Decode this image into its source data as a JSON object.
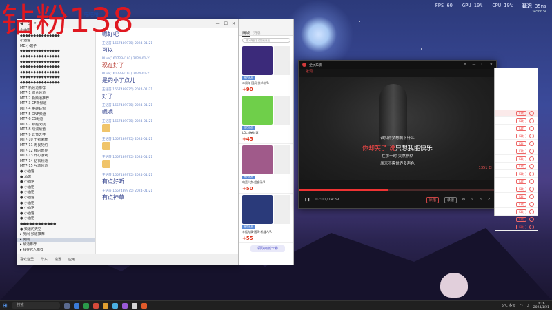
{
  "overlay_text": "钻粉138",
  "hud": {
    "fps": "FPS 60",
    "gpu": "GPU 10%",
    "cpu": "CPU 19%",
    "extra_label": "延迟",
    "extra_val": "35ms",
    "extra_sub": "13456634"
  },
  "chat": {
    "header_name": "喵喵哈",
    "sidebar_items": [
      "小酒馆",
      "◆◆◆◆◆◆◆◆◆◆◆◆◆◆◆",
      "小酒馆",
      "ME 小馆子",
      "◆◆◆◆◆◆◆◆◆◆◆◆◆◆◆",
      "◆◆◆◆◆◆◆◆◆◆◆◆◆◆◆",
      "◆◆◆◆◆◆◆◆◆◆◆◆◆◆◆",
      "◆◆◆◆◆◆◆◆◆◆◆◆◆◆◆",
      "◆◆◆◆◆◆◆◆◆◆◆◆◆◆◆",
      "◆◆◆◆◆◆◆◆◆◆◆◆◆◆◆",
      "◆◆◆◆◆◆◆◆◆◆◆◆◆◆◆",
      "MT7 新频道推荐",
      "MT7-1 综合频道",
      "MT7-2 新频道推荐",
      "MT7-3 CF新频道",
      "MT7-4 英雄联盟",
      "MT7-5 DNF频道",
      "MT7-6 CS频道",
      "MT7-7 穿越火线",
      "MT7-8 动漫频道",
      "MT7-9 云顶之弈",
      "MT7-10 王者荣耀",
      "MT7-11 无畏契约",
      "MT7-12 我的世界",
      "MT7-13 开心游戏",
      "MT7-14 钻石频道",
      "MT7-15 互动频道",
      "● 小酒馆",
      "● 酒馆",
      "● 小酒馆",
      "● 小酒馆",
      "● 小酒馆",
      "● 小酒馆",
      "● 小酒馆",
      "● 小酒馆",
      "● 小酒馆",
      "● 小酒馆",
      "●●●●●●●●●●●●",
      "● 频道的天空",
      "▸ 房间·频道推荐",
      "▸ 房间",
      "▸ 频道推荐",
      "▸ 我在它人推荐",
      "▸ 歌仔里",
      "▸ 留歌推广",
      "▸ 频道推荐",
      "▸ 频道推荐"
    ],
    "messages": [
      {
        "nick": "",
        "text": "嗯好吧",
        "type": "blue"
      },
      {
        "nick": "王钻首(1657489975) 2024-01-21",
        "text": "可以",
        "type": "blue"
      },
      {
        "nick": "BLue(1617234102) 2024-01-21",
        "text": "现在好了",
        "type": "red"
      },
      {
        "nick": "BLue(1617234102) 2024-01-21",
        "text": "是的小了点儿",
        "type": "blue"
      },
      {
        "nick": "王钻首(1657489975) 2024-01-21",
        "text": "好了",
        "type": "blue"
      },
      {
        "nick": "王钻首(1657489975) 2024-01-21",
        "text": "嗯嗯",
        "type": "blue"
      },
      {
        "nick": "王钻首(1657489975) 2024-01-21",
        "text": "",
        "type": "emoji"
      },
      {
        "nick": "王钻首(1657489975) 2024-01-21",
        "text": "",
        "type": "emoji"
      },
      {
        "nick": "王钻首(1657489975) 2024-01-21",
        "text": "",
        "type": "emoji"
      },
      {
        "nick": "王钻首(1657489975) 2024-01-21",
        "text": "有点好听",
        "type": "blue"
      },
      {
        "nick": "王钻首(1657489975) 2024-01-21",
        "text": "有点神草",
        "type": "blue"
      }
    ],
    "bottom": [
      "喜欢这里",
      "华东",
      "设置",
      "应用"
    ],
    "red_badge": "5"
  },
  "shop": {
    "tab_active": "商城",
    "tab_other": "消息",
    "search_placeholder": "输入商品名或搜索商品",
    "items": [
      {
        "name": "二周年·国风·技术轨/R",
        "price": "+90",
        "tag": "官方出品",
        "color": "#3b2a7a"
      },
      {
        "name": "LOL首单特惠",
        "price": "+45",
        "tag": "官方出品",
        "color": "#6fcf4a"
      },
      {
        "name": "电竞少女·组合乐/R",
        "price": "+50",
        "tag": "官方出品",
        "color": "#a05a8a"
      },
      {
        "name": "幸运专属·国风·机器人/R",
        "price": "+55",
        "tag": "官方出品",
        "color": "#2a3a7a"
      }
    ],
    "bottom_btn": "领取商城卡券"
  },
  "player": {
    "title": "全民K歌",
    "subtitle": "歌词",
    "lyrics": [
      "谁扣得梦想剩下什么",
      "你却笑了 说只想我能快乐",
      "在那一时 突然静默",
      "原来不需世界多声色"
    ],
    "time_right": "1351 日",
    "time_pos": "02:00 / 04:39",
    "pill1": "原唱",
    "pill2": "录歌"
  },
  "rwin": {
    "rows": 16,
    "btn_label": "K歌"
  },
  "taskbar": {
    "search": "搜索",
    "weather": "6°C 多云",
    "time": "0:26",
    "date": "2024/1/21"
  }
}
